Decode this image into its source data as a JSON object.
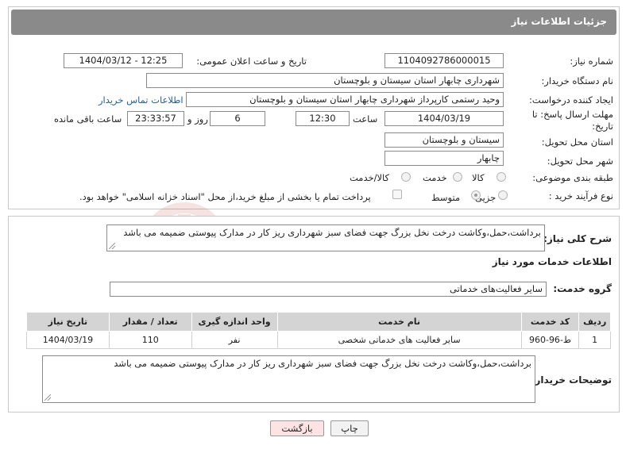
{
  "header": {
    "title": "جزئیات اطلاعات نیاز"
  },
  "fields": {
    "need_number_label": "شماره نیاز:",
    "need_number": "1104092786000015",
    "announce_label": "تاریخ و ساعت اعلان عمومی:",
    "announce_value": "1404/03/12 - 12:25",
    "buyer_org_label": "نام دستگاه خریدار:",
    "buyer_org": "شهرداری چابهار استان سیستان و بلوچستان",
    "requester_label": "ایجاد کننده درخواست:",
    "requester": "وحید رستمی کارپرداز شهرداری چابهار استان سیستان و بلوچستان",
    "contact_link": "اطلاعات تماس خریدار",
    "deadline_label_1": "مهلت ارسال پاسخ: تا",
    "deadline_label_2": "تاریخ:",
    "deadline_date": "1404/03/19",
    "time_label": "ساعت",
    "deadline_time": "12:30",
    "days_value": "6",
    "days_label": "روز و",
    "remaining_time": "23:33:57",
    "remaining_label": "ساعت باقی مانده",
    "province_label": "استان محل تحویل:",
    "province": "سیستان و بلوچستان",
    "city_label": "شهر محل تحویل:",
    "city": "چابهار",
    "category_label": "طبقه بندی موضوعی:",
    "category_options": [
      "کالا",
      "خدمت",
      "کالا/خدمت"
    ],
    "process_label": "نوع فرآیند خرید :",
    "process_options": [
      "جزیی",
      "متوسط"
    ],
    "payment_note": "پرداخت تمام یا بخشی از مبلغ خرید،از محل \"اسناد خزانه اسلامی\" خواهد بود."
  },
  "need": {
    "summary_label": "شرح کلی نیاز:",
    "summary": "برداشت،حمل،وکاشت درخت نخل بزرگ جهت فضای سبز شهرداری ریز کار در مدارک پیوستی ضمیمه می باشد",
    "services_title": "اطلاعات خدمات مورد نیاز",
    "group_label": "گروه خدمت:",
    "group_value": "سایر فعالیت‌های خدماتی"
  },
  "table": {
    "headers": [
      "ردیف",
      "کد خدمت",
      "نام خدمت",
      "واحد اندازه گیری",
      "تعداد / مقدار",
      "تاریخ نیاز"
    ],
    "rows": [
      [
        "1",
        "ط-96-960",
        "سایر فعالیت های خدماتی شخصی",
        "نفر",
        "110",
        "1404/03/19"
      ]
    ]
  },
  "buyer_notes": {
    "label": "توضیحات خریدار:",
    "text": "برداشت،حمل،وکاشت درخت نخل بزرگ جهت فضای سبز شهرداری ریز کار در مدارک پیوستی ضمیمه می باشد"
  },
  "buttons": {
    "print": "چاپ",
    "back": "بازگشت"
  },
  "watermark": {
    "text": "AriaTender.net"
  },
  "colors": {
    "header_bg": "#8a8a8a",
    "link": "#1f5fa8",
    "back_button_bg": "#fde3e3",
    "watermark": "#c62828"
  }
}
